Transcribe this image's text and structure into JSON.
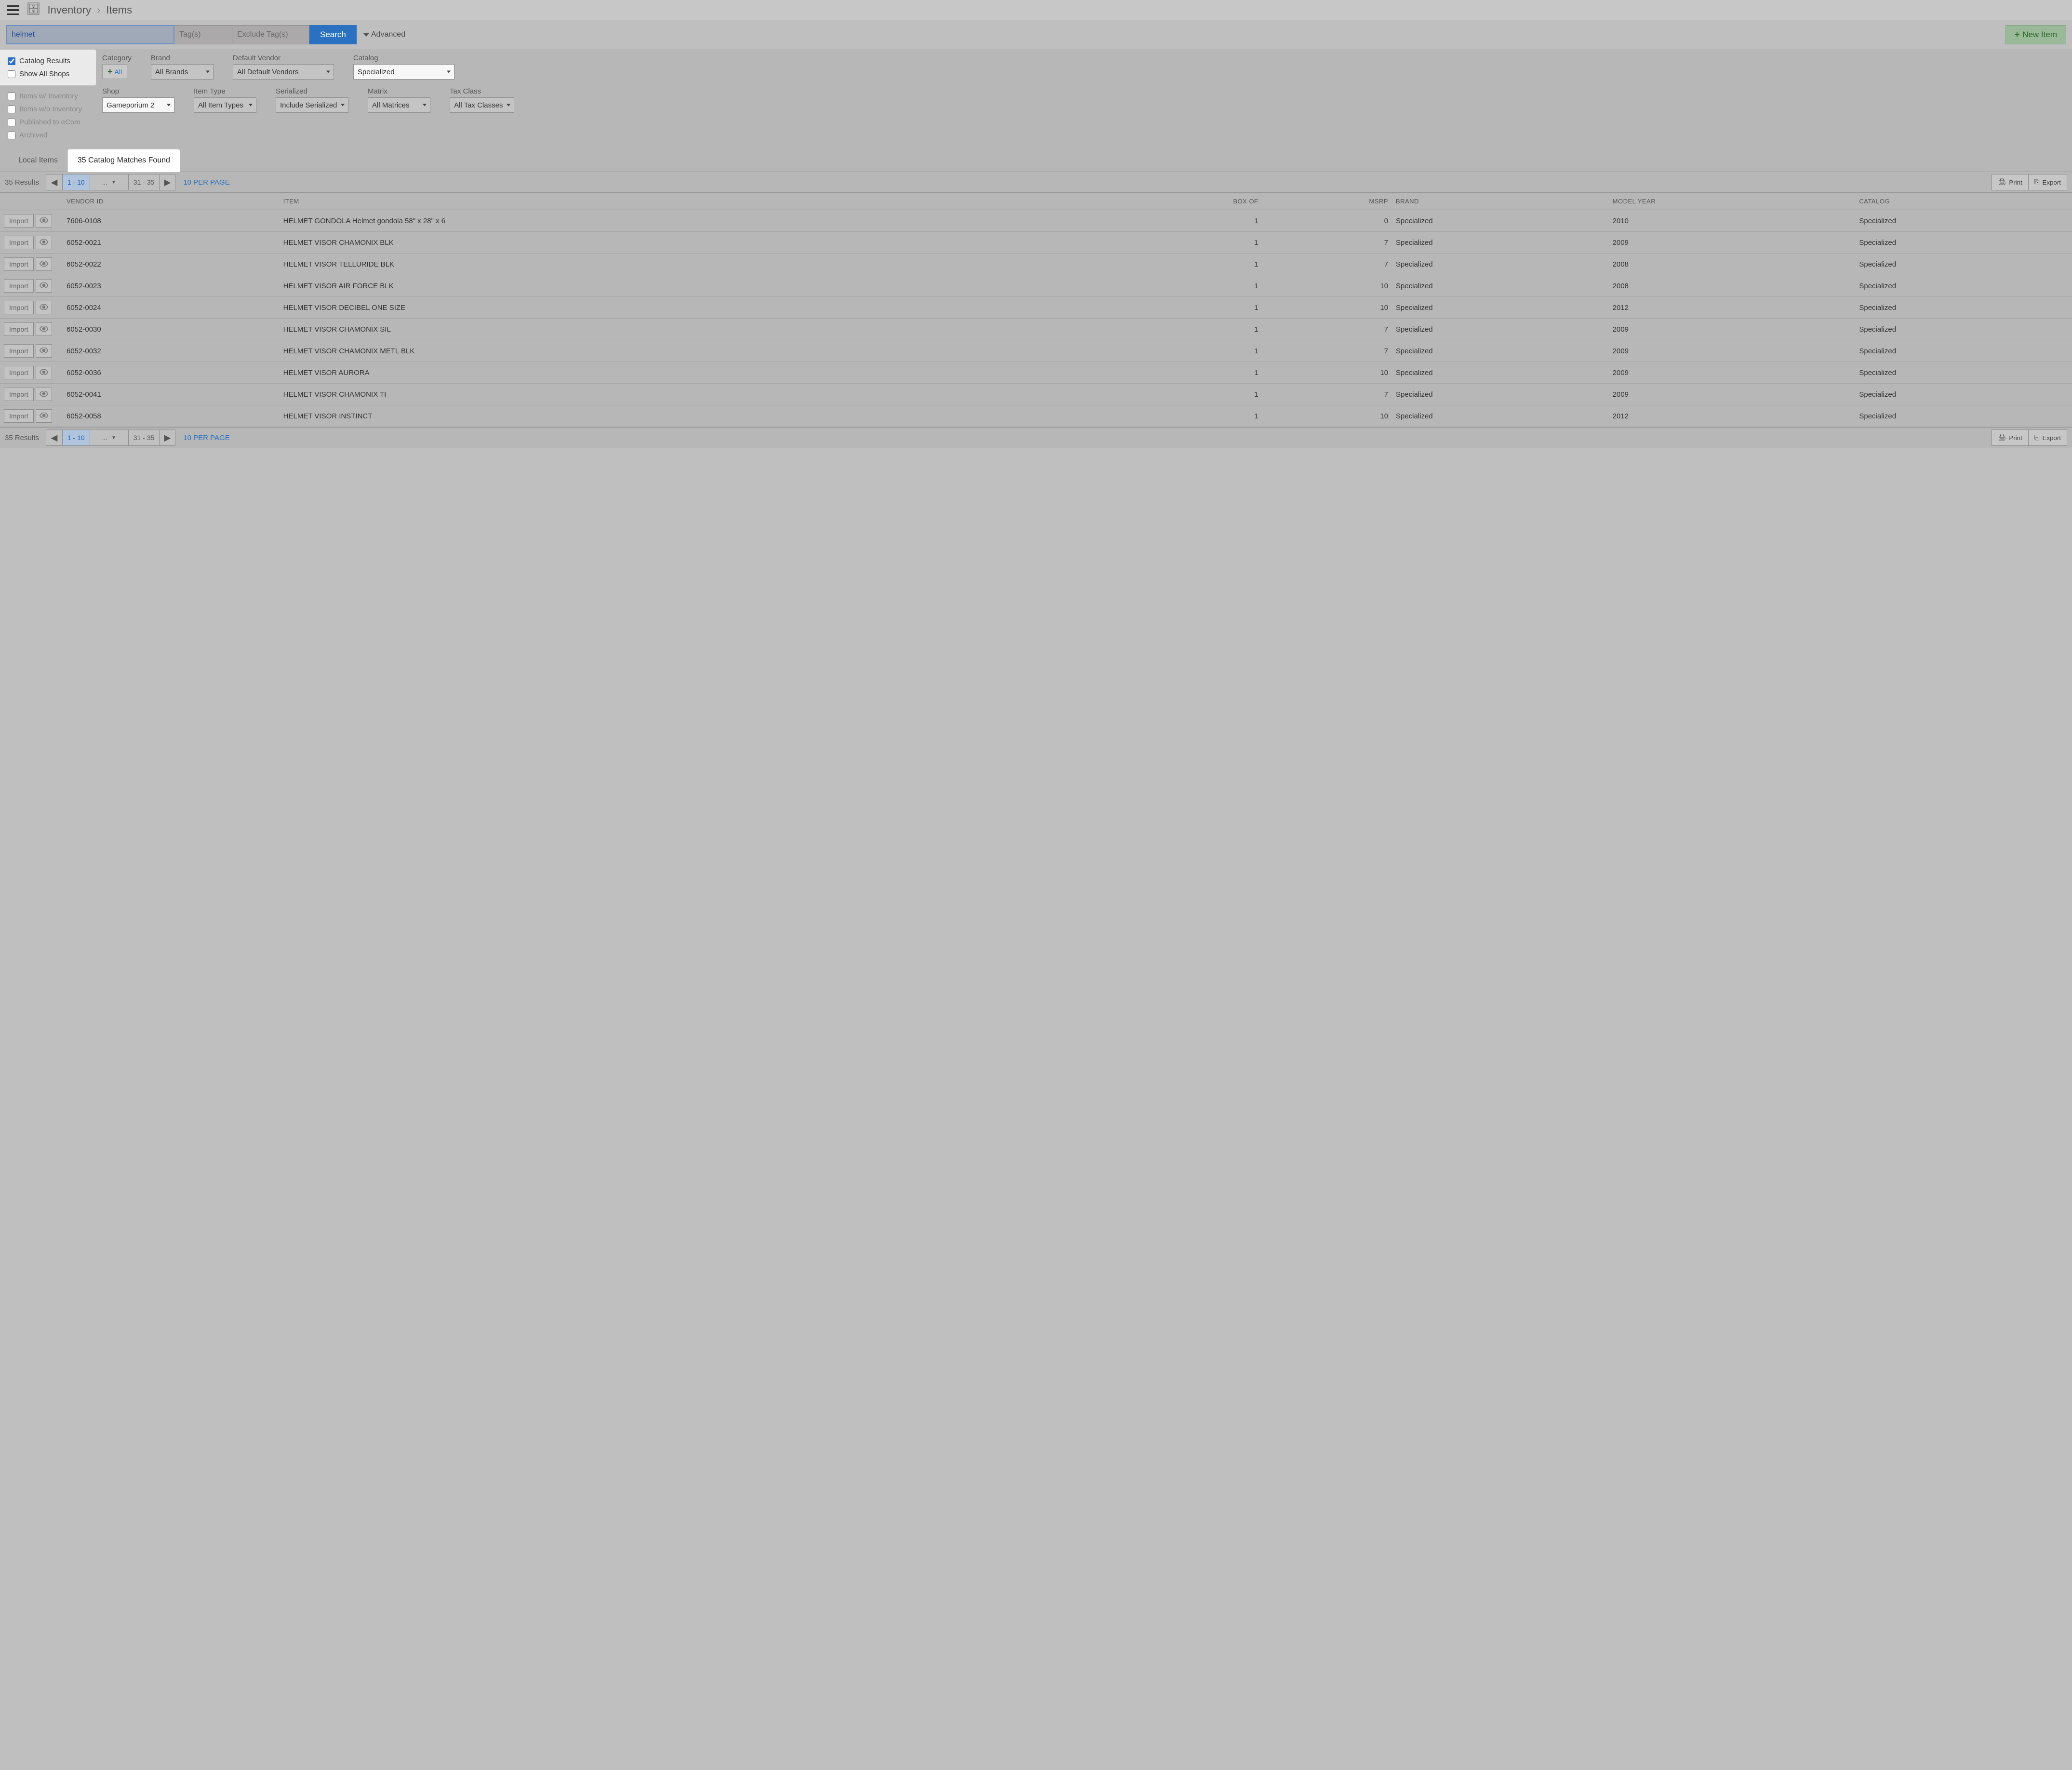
{
  "breadcrumb": {
    "root": "Inventory",
    "page": "Items"
  },
  "search": {
    "value": "helmet",
    "tags_ph": "Tag(s)",
    "extags_ph": "Exclude Tag(s)",
    "button": "Search",
    "advanced": "Advanced",
    "new_item": "New Item"
  },
  "facets": {
    "catalog_results": "Catalog Results",
    "show_all_shops": "Show All Shops",
    "items_w_inventory": "Items w/ Inventory",
    "items_wo_inventory": "Items w/o Inventory",
    "published_ecom": "Published to eCom",
    "archived": "Archived"
  },
  "filters": {
    "category_label": "Category",
    "category_all": "All",
    "brand_label": "Brand",
    "brand_value": "All Brands",
    "vendor_label": "Default Vendor",
    "vendor_value": "All Default Vendors",
    "catalog_label": "Catalog",
    "catalog_value": "Specialized",
    "shop_label": "Shop",
    "shop_value": "Gameporium 2",
    "type_label": "Item Type",
    "type_value": "All Item Types",
    "serialized_label": "Serialized",
    "serialized_value": "Include Serialized",
    "matrix_label": "Matrix",
    "matrix_value": "All Matrices",
    "tax_label": "Tax Class",
    "tax_value": "All Tax Classes"
  },
  "tabs": {
    "local": "Local Items",
    "matches": "35 Catalog Matches Found"
  },
  "pager": {
    "results": "35 Results",
    "range_cur": "1 - 10",
    "range_mid": "...",
    "range_last": "31 - 35",
    "per_page": "10 PER PAGE"
  },
  "tools": {
    "print": "Print",
    "export": "Export"
  },
  "columns": {
    "vendor_id": "VENDOR ID",
    "item": "ITEM",
    "box_of": "BOX OF",
    "msrp": "MSRP",
    "brand": "BRAND",
    "model_year": "MODEL YEAR",
    "catalog": "CATALOG"
  },
  "row_labels": {
    "import": "Import"
  },
  "rows": [
    {
      "vendor_id": "7606-0108",
      "item": "HELMET GONDOLA Helmet gondola 58\" x 28\" x 6",
      "box_of": "1",
      "msrp": "0",
      "brand": "Specialized",
      "year": "2010",
      "catalog": "Specialized"
    },
    {
      "vendor_id": "6052-0021",
      "item": "HELMET VISOR CHAMONIX BLK",
      "box_of": "1",
      "msrp": "7",
      "brand": "Specialized",
      "year": "2009",
      "catalog": "Specialized"
    },
    {
      "vendor_id": "6052-0022",
      "item": "HELMET VISOR TELLURIDE BLK",
      "box_of": "1",
      "msrp": "7",
      "brand": "Specialized",
      "year": "2008",
      "catalog": "Specialized"
    },
    {
      "vendor_id": "6052-0023",
      "item": "HELMET VISOR AIR FORCE BLK",
      "box_of": "1",
      "msrp": "10",
      "brand": "Specialized",
      "year": "2008",
      "catalog": "Specialized"
    },
    {
      "vendor_id": "6052-0024",
      "item": "HELMET VISOR DECIBEL ONE SIZE",
      "box_of": "1",
      "msrp": "10",
      "brand": "Specialized",
      "year": "2012",
      "catalog": "Specialized"
    },
    {
      "vendor_id": "6052-0030",
      "item": "HELMET VISOR CHAMONIX SIL",
      "box_of": "1",
      "msrp": "7",
      "brand": "Specialized",
      "year": "2009",
      "catalog": "Specialized"
    },
    {
      "vendor_id": "6052-0032",
      "item": "HELMET VISOR CHAMONIX METL BLK",
      "box_of": "1",
      "msrp": "7",
      "brand": "Specialized",
      "year": "2009",
      "catalog": "Specialized"
    },
    {
      "vendor_id": "6052-0036",
      "item": "HELMET VISOR AURORA",
      "box_of": "1",
      "msrp": "10",
      "brand": "Specialized",
      "year": "2009",
      "catalog": "Specialized"
    },
    {
      "vendor_id": "6052-0041",
      "item": "HELMET VISOR CHAMONIX TI",
      "box_of": "1",
      "msrp": "7",
      "brand": "Specialized",
      "year": "2009",
      "catalog": "Specialized"
    },
    {
      "vendor_id": "6052-0058",
      "item": "HELMET VISOR INSTINCT",
      "box_of": "1",
      "msrp": "10",
      "brand": "Specialized",
      "year": "2012",
      "catalog": "Specialized"
    }
  ]
}
